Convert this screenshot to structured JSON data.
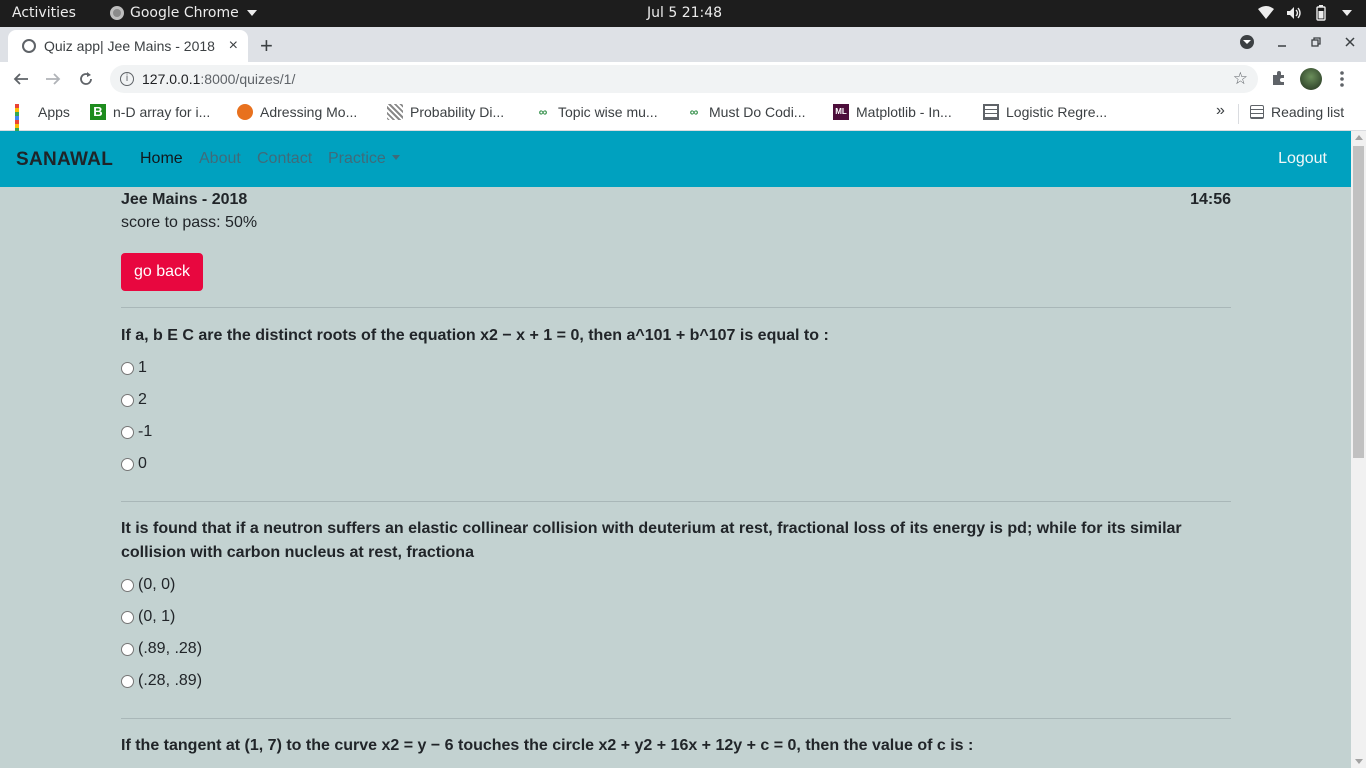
{
  "os_bar": {
    "activities": "Activities",
    "app_name": "Google Chrome",
    "clock": "Jul 5  21:48"
  },
  "browser": {
    "tab_title": "Quiz app| Jee Mains - 2018",
    "tab_close": "×",
    "new_tab": "+",
    "url_host": "127.0.0.1",
    "url_path": ":8000/quizes/1/",
    "bookmarks": [
      {
        "label": "Apps",
        "icon": "apps-grid-icon"
      },
      {
        "label": "n-D array for i...",
        "icon": "b-site-icon"
      },
      {
        "label": "Adressing Mo...",
        "icon": "adressing-site-icon"
      },
      {
        "label": "Probability Di...",
        "icon": "probability-site-icon"
      },
      {
        "label": "Topic wise mu...",
        "icon": "gfg-icon"
      },
      {
        "label": "Must Do Codi...",
        "icon": "gfg-icon"
      },
      {
        "label": "Matplotlib - In...",
        "icon": "ml-site-icon"
      },
      {
        "label": "Logistic Regre...",
        "icon": "logistic-site-icon"
      }
    ],
    "overflow": "»",
    "reading_list": "Reading list"
  },
  "navbar": {
    "brand": "SANAWAL",
    "links": [
      "Home",
      "About",
      "Contact",
      "Practice"
    ],
    "logout": "Logout",
    "colors": {
      "bar": "#00a1bf",
      "active": "#11181c",
      "inactive": "#3f6b7a"
    }
  },
  "quiz": {
    "title": "Jee Mains - 2018",
    "timer": "14:56",
    "pass_score": "score to pass: 50%",
    "back_button": "go back",
    "back_button_color": "#e8073f",
    "questions": [
      {
        "text": "If a, b E C are the distinct roots of the equation x2 − x + 1 = 0, then a^101 + b^107 is equal to :",
        "options": [
          "1",
          "2",
          "-1",
          "0"
        ]
      },
      {
        "text": "It is found that if a neutron suffers an elastic collinear collision with deuterium at rest, fractional loss of its energy is pd; while for its similar collision with carbon nucleus at rest, fractiona",
        "options": [
          "(0, 0)",
          "(0, 1)",
          "(.89, .28)",
          "(.28, .89)"
        ]
      },
      {
        "text": "If the tangent at (1, 7) to the curve x2 = y − 6 touches the circle x2 + y2 + 16x + 12y + c = 0, then the value of c is :",
        "options": []
      }
    ]
  }
}
